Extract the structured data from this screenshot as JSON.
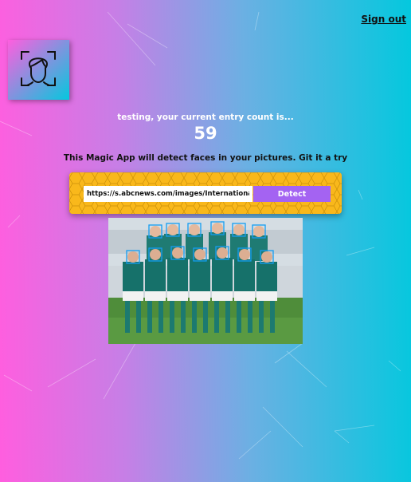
{
  "nav": {
    "signout_label": "Sign out"
  },
  "logo": {
    "icon": "face-recognition-icon"
  },
  "rank": {
    "message": "testing, your current entry count is...",
    "count": "59"
  },
  "tagline": "This Magic App will detect faces in your pictures. Git it a try",
  "form": {
    "url_value": "https://s.abcnews.com/images/International/mexico-world-cup-germany.jpg",
    "detect_label": "Detect"
  },
  "colors": {
    "form_bg": "#f9b81b",
    "button": "#a463f2",
    "face_box": "#149df2"
  },
  "image": {
    "description": "team-photo"
  }
}
